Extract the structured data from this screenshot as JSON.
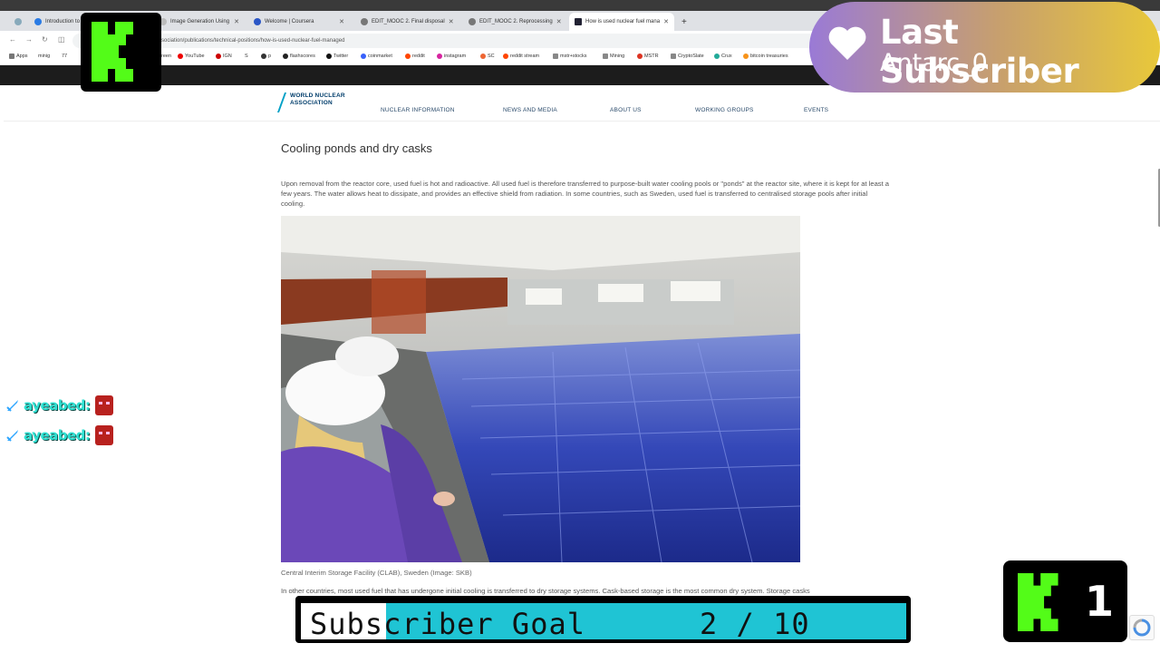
{
  "browser": {
    "tabs": [
      {
        "label": "Introduction to",
        "active": false
      },
      {
        "label": "Image Generation Using",
        "active": false
      },
      {
        "label": "Welcome | Coursera",
        "active": false
      },
      {
        "label": "EDIT_MOOC 2. Final disposal",
        "active": false
      },
      {
        "label": "EDIT_MOOC 2. Reprocessing",
        "active": false
      },
      {
        "label": "How is used nuclear fuel mana",
        "active": true
      }
    ],
    "new_tab": "+",
    "url": "sociation/publications/technical-positions/how-is-used-nuclear-fuel-managed",
    "bookmarks": [
      "Apps",
      "minig",
      "77",
      "reen",
      "YouTube",
      "IGN",
      "S",
      "p",
      "flashscores",
      "Twitter",
      "coinmarket",
      "reddit",
      "instagram",
      "SC",
      "reddit stream",
      "mstr+stocks",
      "Mining",
      "MSTR",
      "CryptoSlate",
      "Crux",
      "bitcoin treasuries"
    ]
  },
  "site": {
    "logo_line1": "WORLD NUCLEAR",
    "logo_line2": "ASSOCIATION",
    "nav": [
      "NUCLEAR INFORMATION",
      "NEWS AND MEDIA",
      "ABOUT US",
      "WORKING GROUPS",
      "EVENTS"
    ],
    "heading": "Cooling ponds and dry casks",
    "para1": "Upon removal from the reactor core, used fuel is hot and radioactive. All used fuel is therefore transferred to purpose-built water cooling pools or \"ponds\" at the reactor site, where it is kept for at least a few years. The water allows heat to dissipate, and provides an effective shield from radiation. In some countries, such as Sweden, used fuel is transferred to centralised storage pools after initial cooling.",
    "caption": "Central Interim Storage Facility (CLAB), Sweden (Image: SKB)",
    "para2": "In other countries, most used fuel that has undergone initial cooling is transferred to dry storage systems. Cask-based storage is the most common dry system. Storage casks"
  },
  "overlay": {
    "last_subscriber_title": "Last Subscriber",
    "last_subscriber_name": "Antarc_0",
    "chat": [
      {
        "user": "ayeabed:"
      },
      {
        "user": "ayeabed:"
      }
    ],
    "goal_label": "Subscriber Goal",
    "goal_count": "2 / 10",
    "goal_progress": 0.2,
    "kick_count": "1",
    "colors": {
      "kick_green": "#53fc18",
      "goal_fill": "#1fc4d4",
      "chat_name": "#2ee0d2"
    }
  }
}
